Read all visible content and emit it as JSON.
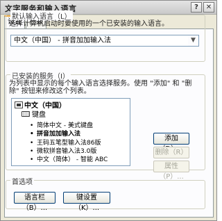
{
  "window": {
    "title": "文字服务和输入语言",
    "help_label": "?",
    "close_label": "✕"
  },
  "tabs": [
    {
      "label": "设置",
      "active": true
    },
    {
      "label": "高级",
      "active": false
    }
  ],
  "default_language": {
    "group_label": "默认输入语言（L）",
    "description": "选择计算机启动时要使用的一个已安装的输入语言。",
    "selected": "中文（中国） - 拼音加加输入法",
    "arrow_icon": "chevron-down-icon"
  },
  "installed_services": {
    "group_label": "已安装的服务（I）",
    "description": "为列表中显示的每个输入语言选择服务。使用 \"添加\" 和 \"删除\" 按钮来修改这个列表。",
    "language": "中文（中国）",
    "keyboard_label": "键盘",
    "items": [
      {
        "label": "简体中文 - 美式键盘",
        "bold": false
      },
      {
        "label": "拼音加加输入法",
        "bold": true
      },
      {
        "label": "王码五笔型输入法86版",
        "bold": false
      },
      {
        "label": "微软拼音输入法3.0版",
        "bold": false
      },
      {
        "label": "中文（简体） - 智能 ABC",
        "bold": false
      }
    ],
    "bullet": "•",
    "add_label": "添加（D）...",
    "remove_label": "删除（R）",
    "properties_label": "属性（P）..."
  },
  "preferences": {
    "group_label": "首选项",
    "language_bar_label": "语言栏（B）...",
    "key_settings_label": "键设置（K）..."
  }
}
